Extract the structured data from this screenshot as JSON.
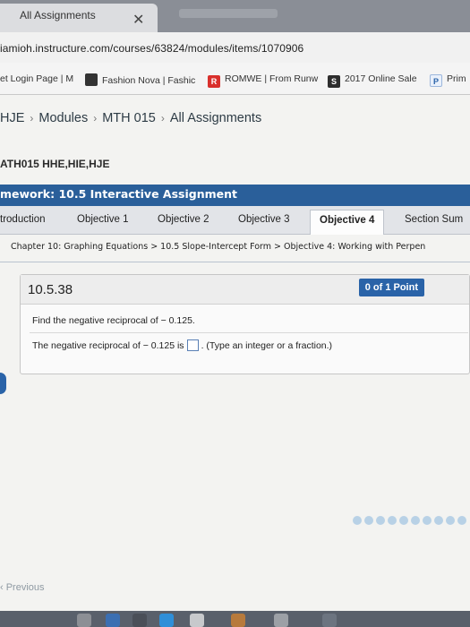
{
  "browser": {
    "tab_title": "All Assignments",
    "tab_close": "✕",
    "address": "iamioh.instructure.com/courses/63824/modules/items/1070906",
    "bookmarks": [
      {
        "label": "et Login Page | M"
      },
      {
        "label": "Fashion Nova | Fashic"
      },
      {
        "label": "ROMWE | From Runw",
        "icon_text": "R"
      },
      {
        "label": "2017 Online Sale",
        "icon_text": "S"
      },
      {
        "label": "Prim",
        "icon_text": "P"
      }
    ]
  },
  "breadcrumb": {
    "items": [
      "HJE",
      "Modules",
      "MTH 015",
      "All Assignments"
    ],
    "separator": "›"
  },
  "course_title": "ATH015 HHE,HIE,HJE",
  "homework_title": "mework: 10.5 Interactive Assignment",
  "objective_tabs": [
    {
      "label": "troduction"
    },
    {
      "label": "Objective 1"
    },
    {
      "label": "Objective 2"
    },
    {
      "label": "Objective 3"
    },
    {
      "label": "Objective 4"
    },
    {
      "label": "Section Sum"
    }
  ],
  "chapter_breadcrumb": "Chapter 10: Graphing Equations > 10.5 Slope-Intercept Form > Objective 4: Working with Perpen",
  "question": {
    "number": "10.5.38",
    "points": "0 of 1 Point",
    "prompt": "Find the negative reciprocal of − 0.125.",
    "answer_prefix": "The negative reciprocal of − 0.125 is",
    "answer_hint": ". (Type an integer or a fraction.)"
  },
  "footer": {
    "previous": "‹ Previous"
  },
  "colors": {
    "accent": "#2a5f9a",
    "points_badge": "#2a63a8"
  }
}
